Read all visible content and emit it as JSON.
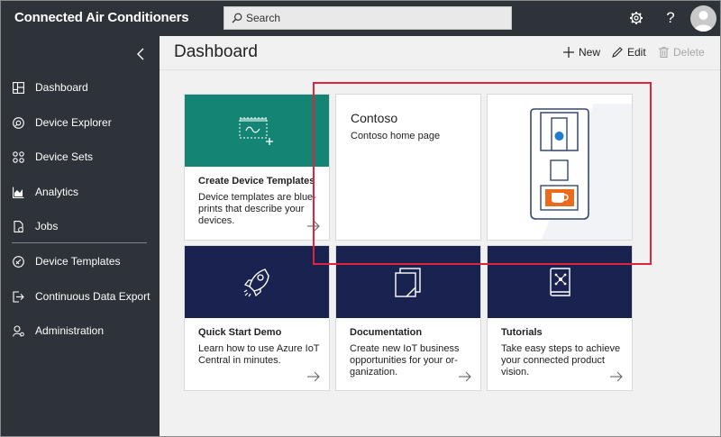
{
  "app": {
    "title": "Connected Air Conditioners"
  },
  "search": {
    "placeholder": "Search"
  },
  "header_icons": {
    "settings": "gear-icon",
    "help_glyph": "?",
    "help": "help-icon",
    "account": "avatar-icon"
  },
  "sidebar": {
    "collapse_icon": "chevron-left-icon",
    "items": [
      {
        "label": "Dashboard",
        "icon": "dashboard-icon"
      },
      {
        "label": "Device Explorer",
        "icon": "device-explorer-icon"
      },
      {
        "label": "Device Sets",
        "icon": "device-sets-icon"
      },
      {
        "label": "Analytics",
        "icon": "analytics-icon"
      },
      {
        "label": "Jobs",
        "icon": "jobs-icon"
      },
      {
        "label": "Device Templates",
        "icon": "device-templates-icon"
      },
      {
        "label": "Continuous Data Export",
        "icon": "data-export-icon"
      },
      {
        "label": "Administration",
        "icon": "administration-icon"
      }
    ]
  },
  "main": {
    "title": "Dashboard",
    "commands": [
      {
        "label": "New",
        "icon": "plus-icon",
        "enabled": true
      },
      {
        "label": "Edit",
        "icon": "pencil-icon",
        "enabled": true
      },
      {
        "label": "Delete",
        "icon": "trash-icon",
        "enabled": false
      }
    ],
    "tiles": [
      {
        "title": "Create Device Templates",
        "description": "Device templates are blue-prints that describe your devices.",
        "icon": "device-template-icon"
      },
      {
        "title": "Contoso",
        "description": "Contoso home page"
      },
      {
        "image": "coffee-machine-image"
      },
      {
        "title": "Quick Start Demo",
        "description": "Learn how to use Azure IoT Central in minutes.",
        "icon": "rocket-icon"
      },
      {
        "title": "Documentation",
        "description": "Create new IoT business opportunities for your or-ganization.",
        "icon": "documents-icon"
      },
      {
        "title": "Tutorials",
        "description": "Take easy steps to achieve your connected product vision.",
        "icon": "book-icon"
      }
    ]
  },
  "colors": {
    "topbar": "#2d3338",
    "green_band": "#148574",
    "navy_band": "#1a2350",
    "highlight": "#e0243e",
    "coffee_orange": "#ec6a1b",
    "coffee_blue": "#1f7ecf"
  }
}
